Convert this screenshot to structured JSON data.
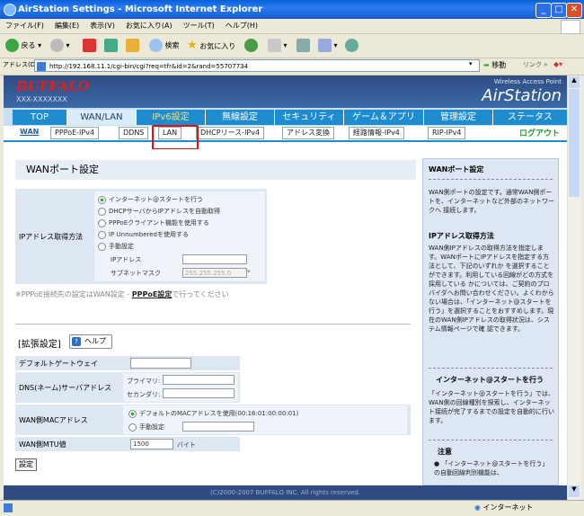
{
  "window": {
    "title": "AirStation Settings - Microsoft Internet Explorer"
  },
  "menu": [
    "ファイル(F)",
    "編集(E)",
    "表示(V)",
    "お気に入り(A)",
    "ツール(T)",
    "ヘルプ(H)"
  ],
  "toolbar": {
    "back": "戻る",
    "search": "検索",
    "favorites": "お気に入り"
  },
  "address": {
    "label": "アドレス(D)",
    "url": "http://192.168.11.1/cgi-bin/cgi?req=tfr&id=2&rand=55707734",
    "go": "移動",
    "links": "リンク"
  },
  "header": {
    "logo": "BUFFALO",
    "model": "XXX-XXXXXXX",
    "wap": "Wireless Access Point",
    "brand": "AirStation"
  },
  "tabs": [
    "TOP",
    "WAN/LAN",
    "IPv6設定",
    "無線設定",
    "セキュリティ",
    "ゲーム＆アプリ",
    "管理設定",
    "ステータス"
  ],
  "subtabs": [
    "WAN",
    "PPPoE-IPv4",
    "DDNS",
    "LAN",
    "DHCPリース-IPv4",
    "アドレス変換",
    "経路情報-IPv4",
    "RIP-IPv4"
  ],
  "logout": "ログアウト",
  "main": {
    "title": "WANポート設定",
    "ip_label": "IPアドレス取得方法",
    "ip_options": [
      "インターネット@スタートを行う",
      "DHCPサーバからIPアドレスを自動取得",
      "PPPoEクライアント機能を使用する",
      "IP Unnumberedを使用する",
      "手動設定"
    ],
    "ip_addr_label": "IPアドレス",
    "subnet_label": "サブネットマスク",
    "subnet_value": "255.255.255.0",
    "note_prefix": "※PPPoE接続先の設定はWAN設定 - ",
    "note_link": "PPPoE設定",
    "note_suffix": "で行ってください",
    "ext_title": "[拡張設定]",
    "help": "ヘルプ",
    "gateway_label": "デフォルトゲートウェイ",
    "dns_label": "DNS(ネーム)サーバアドレス",
    "dns_primary": "プライマリ:",
    "dns_secondary": "セカンダリ:",
    "mac_label": "WAN側MACアドレス",
    "mac_default": "デフォルトのMACアドレスを使用(00:16:01:00:00:01)",
    "mac_manual": "手動設定",
    "mtu_label": "WAN側MTU値",
    "mtu_value": "1500",
    "mtu_unit": "バイト",
    "save": "設定"
  },
  "footer": "(C)2000-2007 BUFFALO INC. All rights reserved.",
  "side": {
    "h1": "WANポート設定",
    "p1": "WAN側ポートの設定です。通常WAN側ポートを、インターネットなど外部のネットワークへ 接続します。",
    "h2": "IPアドレス取得方法",
    "p2": "WAN側IPアドレスの取得方法を指定します。WANポートにIPアドレスを指定する方法として、下記のいずれか を選択することができます。利用している回線がどの方式を採用している かについては、ご契約のプロバイダへお問い合わせください。よくわからない場合は、「インターネット@スタートを行う」を選択することをおすすめします。現在のWAN側IPアドレスの取得状況は、システム情報ページで確 認できます。",
    "h3": "インターネット@スタートを行う",
    "p3": "「インターネット@スタートを行う」では、WAN側の回線種別を探索し、インターネット接続が完了するまでの設定を自動的に行います。",
    "h4": "注意",
    "p4": "● 「インターネット@スタートを行う」の自動回線判別機能は、"
  },
  "status": {
    "zone": "インターネット"
  }
}
